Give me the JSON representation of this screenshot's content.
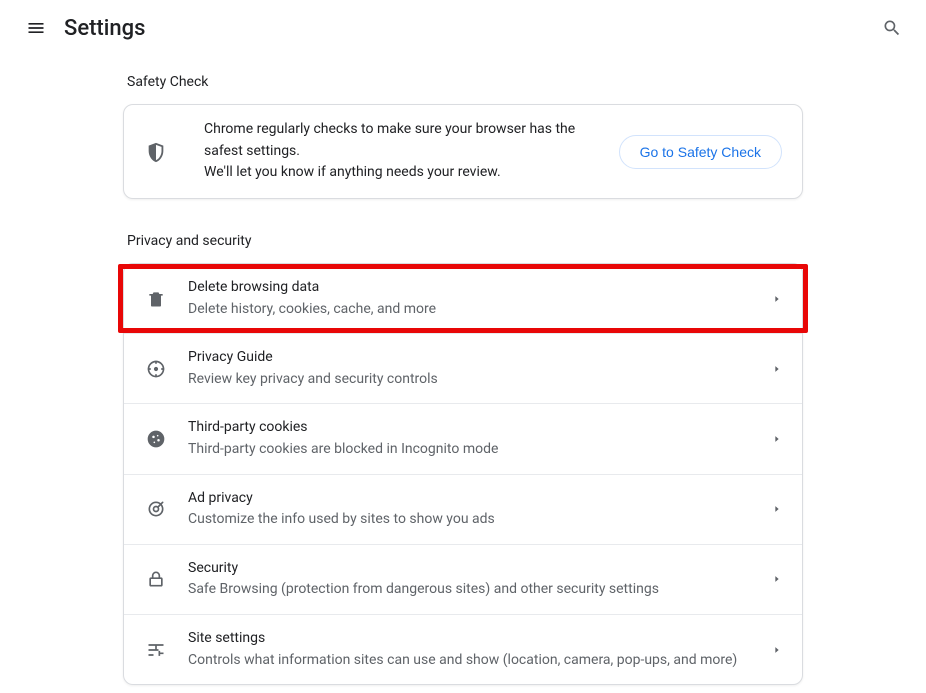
{
  "header": {
    "title": "Settings"
  },
  "safety": {
    "section_label": "Safety Check",
    "line1": "Chrome regularly checks to make sure your browser has the safest settings.",
    "line2": "We'll let you know if anything needs your review.",
    "button": "Go to Safety Check"
  },
  "privacy": {
    "section_label": "Privacy and security",
    "rows": [
      {
        "title": "Delete browsing data",
        "sub": "Delete history, cookies, cache, and more"
      },
      {
        "title": "Privacy Guide",
        "sub": "Review key privacy and security controls"
      },
      {
        "title": "Third-party cookies",
        "sub": "Third-party cookies are blocked in Incognito mode"
      },
      {
        "title": "Ad privacy",
        "sub": "Customize the info used by sites to show you ads"
      },
      {
        "title": "Security",
        "sub": "Safe Browsing (protection from dangerous sites) and other security settings"
      },
      {
        "title": "Site settings",
        "sub": "Controls what information sites can use and show (location, camera, pop-ups, and more)"
      }
    ]
  }
}
